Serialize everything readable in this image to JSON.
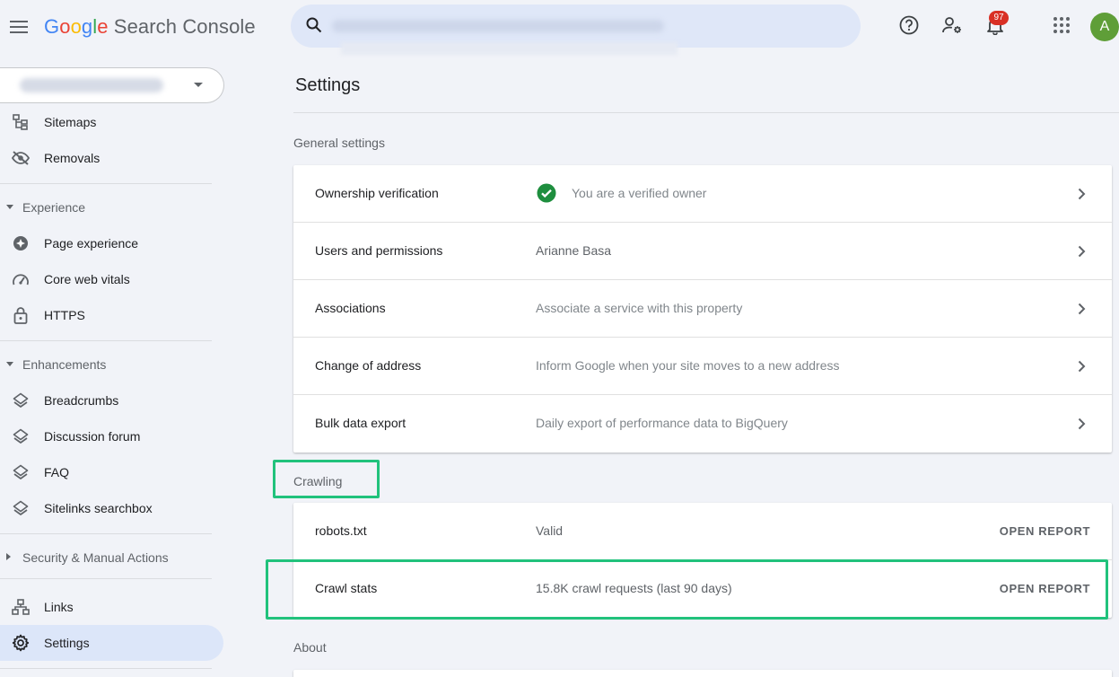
{
  "header": {
    "brand_letters": [
      "G",
      "o",
      "o",
      "g",
      "l",
      "e"
    ],
    "brand_rest": " Search Console",
    "search_placeholder": "",
    "notification_count": "97",
    "avatar_letter": "A",
    "icons": [
      "menu-icon",
      "search-icon",
      "help-icon",
      "manage-users-icon",
      "notifications-icon",
      "apps-icon"
    ]
  },
  "sidebar": {
    "items_top": [
      {
        "label": "Sitemaps",
        "icon": "sitemap-icon"
      },
      {
        "label": "Removals",
        "icon": "eye-off-icon"
      }
    ],
    "experience": {
      "header": "Experience",
      "items": [
        {
          "label": "Page experience",
          "icon": "plus-circle-icon"
        },
        {
          "label": "Core web vitals",
          "icon": "speedometer-icon"
        },
        {
          "label": "HTTPS",
          "icon": "lock-icon"
        }
      ]
    },
    "enhancements": {
      "header": "Enhancements",
      "items": [
        {
          "label": "Breadcrumbs",
          "icon": "layers-icon"
        },
        {
          "label": "Discussion forum",
          "icon": "layers-icon"
        },
        {
          "label": "FAQ",
          "icon": "layers-icon"
        },
        {
          "label": "Sitelinks searchbox",
          "icon": "layers-icon"
        }
      ]
    },
    "security_header": "Security & Manual Actions",
    "items_bottom": [
      {
        "label": "Links",
        "icon": "links-icon"
      },
      {
        "label": "Settings",
        "icon": "gear-icon"
      }
    ]
  },
  "main": {
    "title": "Settings",
    "general": {
      "label": "General settings",
      "rows": [
        {
          "name": "Ownership verification",
          "value": "You are a verified owner"
        },
        {
          "name": "Users and permissions",
          "value": "Arianne Basa"
        },
        {
          "name": "Associations",
          "value": "Associate a service with this property"
        },
        {
          "name": "Change of address",
          "value": "Inform Google when your site moves to a new address"
        },
        {
          "name": "Bulk data export",
          "value": "Daily export of performance data to BigQuery"
        }
      ]
    },
    "crawling": {
      "label": "Crawling",
      "rows": [
        {
          "name": "robots.txt",
          "value": "Valid",
          "action": "OPEN REPORT"
        },
        {
          "name": "Crawl stats",
          "value": "15.8K crawl requests (last 90 days)",
          "action": "OPEN REPORT"
        }
      ]
    },
    "about_label": "About"
  },
  "colors": {
    "highlight": "#21c27c",
    "active_nav": "#dce6f9",
    "check_green": "#1e8e3e"
  }
}
